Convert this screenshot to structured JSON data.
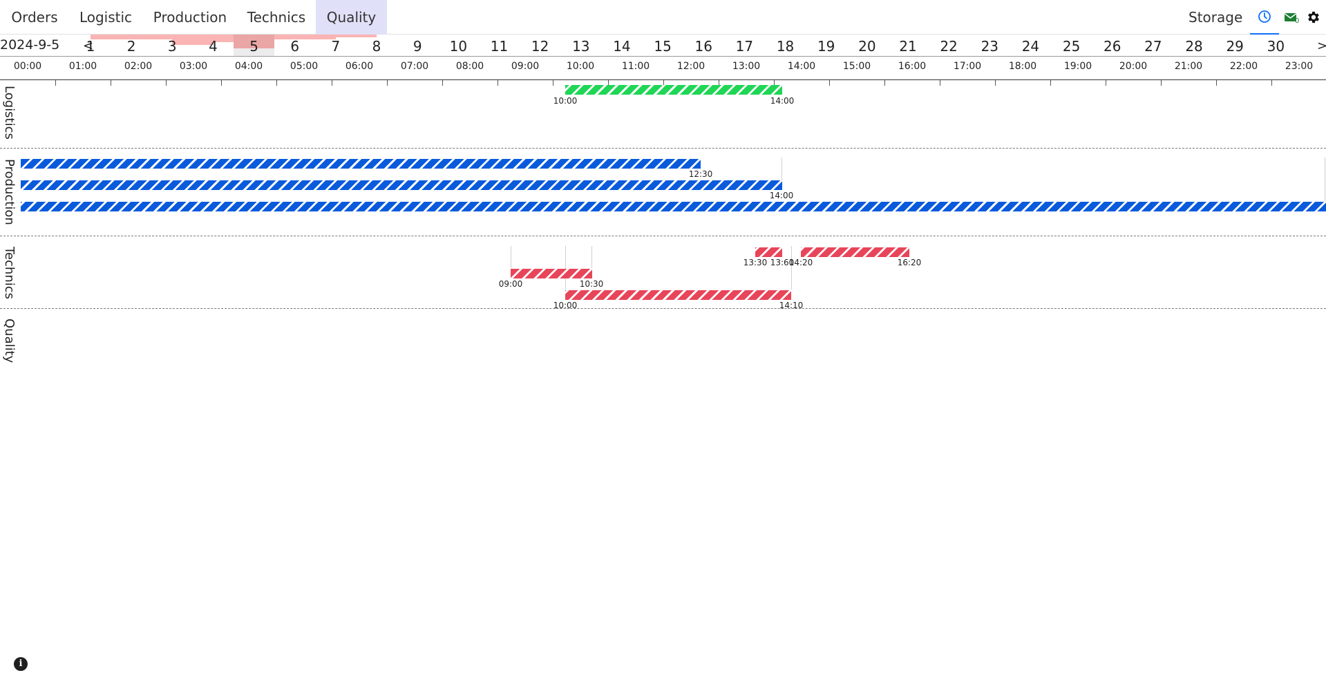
{
  "nav": {
    "tabs": [
      {
        "label": "Orders"
      },
      {
        "label": "Logistic"
      },
      {
        "label": "Production"
      },
      {
        "label": "Technics"
      },
      {
        "label": "Quality"
      }
    ],
    "storage_label": "Storage",
    "mail_count": "0",
    "icons": [
      "clock-icon",
      "mail-icon",
      "gear-icon"
    ]
  },
  "date": {
    "current": "2024-9-5",
    "prev": "<",
    "next": ">",
    "days": [
      "1",
      "2",
      "3",
      "4",
      "5",
      "6",
      "7",
      "8",
      "9",
      "10",
      "11",
      "12",
      "13",
      "14",
      "15",
      "16",
      "17",
      "18",
      "19",
      "20",
      "21",
      "22",
      "23",
      "24",
      "25",
      "26",
      "27",
      "28",
      "29",
      "30"
    ],
    "selected_day": "5"
  },
  "hours": [
    "00:00",
    "01:00",
    "02:00",
    "03:00",
    "04:00",
    "05:00",
    "06:00",
    "07:00",
    "08:00",
    "09:00",
    "10:00",
    "11:00",
    "12:00",
    "13:00",
    "14:00",
    "15:00",
    "16:00",
    "17:00",
    "18:00",
    "19:00",
    "20:00",
    "21:00",
    "22:00",
    "23:00"
  ],
  "lanes": [
    {
      "label": "Logistics"
    },
    {
      "label": "Production"
    },
    {
      "label": "Technics"
    },
    {
      "label": "Quality"
    }
  ],
  "bars": {
    "logistics": [
      {
        "start": "10:00",
        "end": "14:00",
        "color": "#1fd655"
      }
    ],
    "production": [
      {
        "start": "",
        "end": "12:30",
        "color": "#0a5bdc"
      },
      {
        "start": "",
        "end": "14:00",
        "color": "#0a5bdc"
      },
      {
        "start": "",
        "end": "",
        "color": "#0a5bdc"
      }
    ],
    "technics": [
      {
        "start": "09:00",
        "end": "10:30",
        "color": "#e8455a"
      },
      {
        "start": "10:00",
        "end": "14:10",
        "color": "#e8455a"
      },
      {
        "start": "13:30",
        "end": "13:60",
        "color": "#e8455a"
      },
      {
        "start": "14:20",
        "end": "16:20",
        "color": "#e8455a"
      }
    ]
  },
  "info_icon": "i"
}
